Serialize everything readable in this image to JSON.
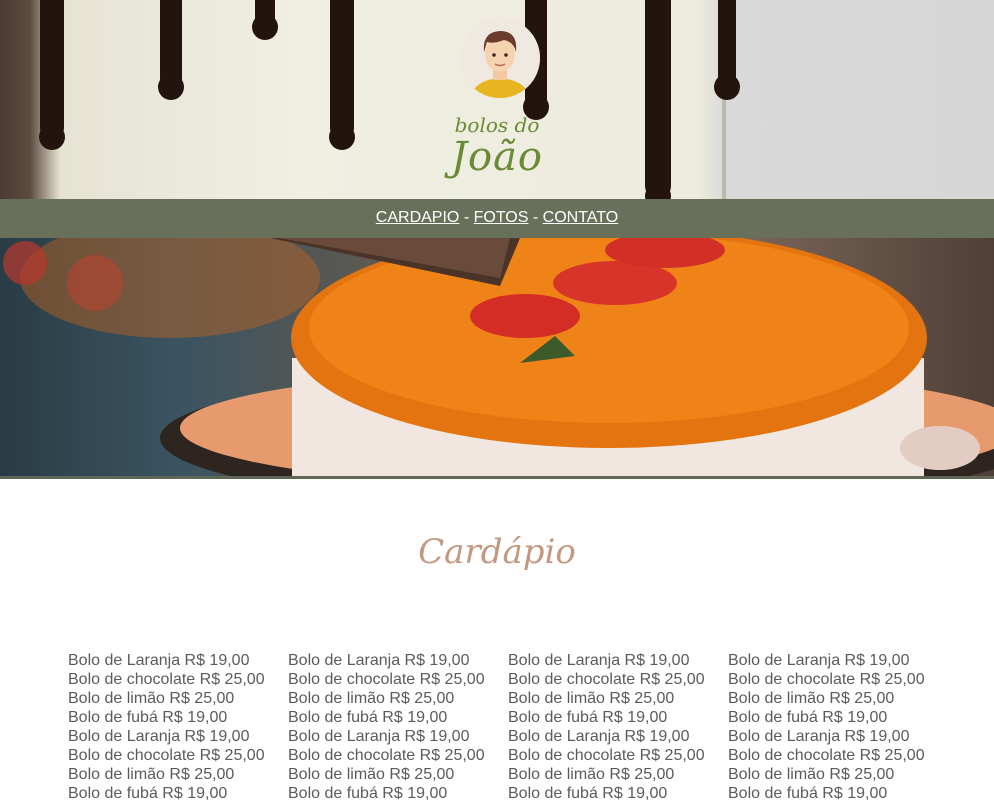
{
  "header": {
    "logo_small": "bolos do",
    "logo_big": "João"
  },
  "nav": {
    "items": [
      "CARDAPIO",
      "FOTOS",
      "CONTATO"
    ],
    "separator": "-"
  },
  "menu": {
    "title": "Cardápio",
    "columns": [
      [
        "Bolo de Laranja R$ 19,00",
        "Bolo de chocolate R$ 25,00",
        "Bolo de limão R$ 25,00",
        "Bolo de fubá R$ 19,00",
        "Bolo de Laranja R$ 19,00",
        "Bolo de chocolate R$ 25,00",
        "Bolo de limão R$ 25,00",
        "Bolo de fubá R$ 19,00"
      ],
      [
        "Bolo de Laranja R$ 19,00",
        "Bolo de chocolate R$ 25,00",
        "Bolo de limão R$ 25,00",
        "Bolo de fubá R$ 19,00",
        "Bolo de Laranja R$ 19,00",
        "Bolo de chocolate R$ 25,00",
        "Bolo de limão R$ 25,00",
        "Bolo de fubá R$ 19,00"
      ],
      [
        "Bolo de Laranja R$ 19,00",
        "Bolo de chocolate R$ 25,00",
        "Bolo de limão R$ 25,00",
        "Bolo de fubá R$ 19,00",
        "Bolo de Laranja R$ 19,00",
        "Bolo de chocolate R$ 25,00",
        "Bolo de limão R$ 25,00",
        "Bolo de fubá R$ 19,00"
      ],
      [
        "Bolo de Laranja R$ 19,00",
        "Bolo de chocolate R$ 25,00",
        "Bolo de limão R$ 25,00",
        "Bolo de fubá R$ 19,00",
        "Bolo de Laranja R$ 19,00",
        "Bolo de chocolate R$ 25,00",
        "Bolo de limão R$ 25,00",
        "Bolo de fubá R$ 19,00"
      ]
    ]
  },
  "colors": {
    "nav_bg": "#69705a",
    "logo": "#6b8a35",
    "menu_title": "#c4987f",
    "menu_text": "#5b5b5b"
  }
}
